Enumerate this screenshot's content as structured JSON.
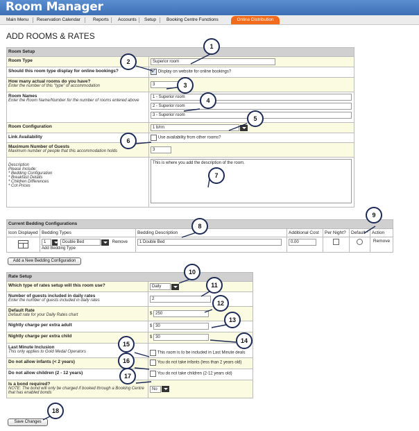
{
  "app": {
    "title": "Room Manager"
  },
  "nav": {
    "items": [
      "Main Menu",
      "Reservation Calendar",
      "Reports",
      "Accounts",
      "Setup",
      "Booking Centre Functions"
    ],
    "active": "Online Distribution"
  },
  "page": {
    "title": "ADD ROOMS & RATES"
  },
  "room_setup": {
    "heading": "Room Setup",
    "room_type_label": "Room Type",
    "room_type_value": "Superior  room",
    "display_online_label": "Should this room type display for online bookings?",
    "display_online_text": "Display on website for online bookings?",
    "display_online_checked": true,
    "how_many_label": "How many actual rooms do you have?",
    "how_many_sub": "Enter the number of this \"type\" of accommodation",
    "how_many_value": "3",
    "room_names_label": "Room Names",
    "room_names_sub": "Enter the Room Name/Number for the number of rooms entered above",
    "room_names": [
      "1 - Superior  room",
      "2 - Superior  room",
      "3 - Superior  room"
    ],
    "config_label": "Room Configuration",
    "config_value": "1 b/rm",
    "link_label": "Link Availability",
    "link_text": "Use availability from other rooms?",
    "max_guests_label": "Maximum Number of Guests",
    "max_guests_sub": "Maximum number of people that this accommodation holds",
    "max_guests_value": "3",
    "description_label": "Description",
    "description_sub": [
      "Please Include:",
      "* Bedding Configuration",
      "* Breakfast Details",
      "* Children Differences",
      "* Cot Prices"
    ],
    "description_value": "This is where you add the description of the room."
  },
  "bedding": {
    "heading": "Current Bedding Configurations",
    "columns": [
      "Icon Displayed",
      "Bedding Types",
      "Bedding Description",
      "Additional Cost",
      "Per Night?",
      "Default *",
      "Action"
    ],
    "row": {
      "qty": "1",
      "type": "Double Bed",
      "remove_link": "Remove",
      "add_link": "Add Bedding Type",
      "description": "1 Double Bed",
      "cost": "0.00",
      "action": "Remove"
    },
    "add_button": "Add a New Bedding Configuration"
  },
  "rate_setup": {
    "heading": "Rate Setup",
    "type_label": "Which type of rates setup will this room use?",
    "type_value": "Daily",
    "guests_label": "Number of guests included in daily rates",
    "guests_sub": "Enter the number of guests included in daily rates",
    "guests_value": "2",
    "default_label": "Default Rate",
    "default_sub": "Default rate for your Daily Rates chart",
    "default_value": "250",
    "adult_label": "Nightly charge per extra adult",
    "adult_value": "30",
    "child_label": "Nightly charge per extra child",
    "child_value": "30",
    "currency": "$",
    "lastminute_label": "Last Minute Inclusion",
    "lastminute_sub": "This only applies to Gold Medal Operators",
    "lastminute_text": "This room is to be included in Last Minute deals",
    "infants_label": "Do not allow infants (< 2 years)",
    "infants_text": "You do not take infants (less than 2 years old)",
    "children_label": "Do not allow children (2 - 12 years)",
    "children_text": "You do not take children (2-12 years old)",
    "bond_label": "Is a bond required?",
    "bond_sub": "NOTE: The bond will only be charged if booked through a Booking Centre that has enabled bonds",
    "bond_value": "No"
  },
  "save_button": "Save Changes",
  "callouts": [
    "1",
    "2",
    "3",
    "4",
    "5",
    "6",
    "7",
    "8",
    "9",
    "10",
    "11",
    "12",
    "13",
    "14",
    "15",
    "16",
    "17",
    "18"
  ],
  "colors": {
    "header": "#4a7fc4",
    "active_tab": "#f26b1d",
    "section_head": "#d0d0d0",
    "row_tint": "#fbfbe2"
  }
}
